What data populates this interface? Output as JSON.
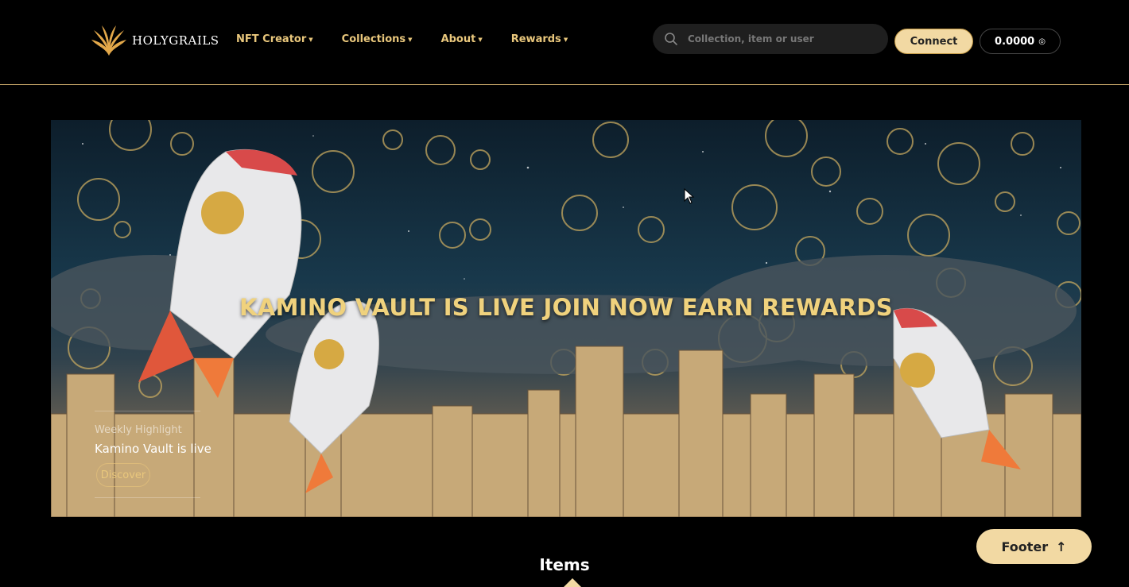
{
  "brand": {
    "name": "HOLYGRAILS"
  },
  "nav": {
    "items": [
      {
        "label": "NFT Creator"
      },
      {
        "label": "Collections"
      },
      {
        "label": "About"
      },
      {
        "label": "Rewards"
      }
    ],
    "caret_icon": "caret-down-icon"
  },
  "search": {
    "placeholder": "Collection, item or user",
    "icon": "search-icon"
  },
  "connect": {
    "label": "Connect"
  },
  "wallet": {
    "balance": "0.0000",
    "currency_icon": "sol-icon"
  },
  "banner": {
    "title": "KAMINO VAULT IS LIVE JOIN NOW EARN REWARDS",
    "highlight_label": "Weekly Highlight",
    "highlight_title": "Kamino Vault is live",
    "cta_label": "Discover"
  },
  "items": {
    "heading": "Items"
  },
  "footer_button": {
    "label": "Footer",
    "icon": "arrow-up-icon"
  },
  "colors": {
    "accent": "#e9c77c",
    "connect_bg": "#f2d9a3",
    "background": "#000000"
  }
}
